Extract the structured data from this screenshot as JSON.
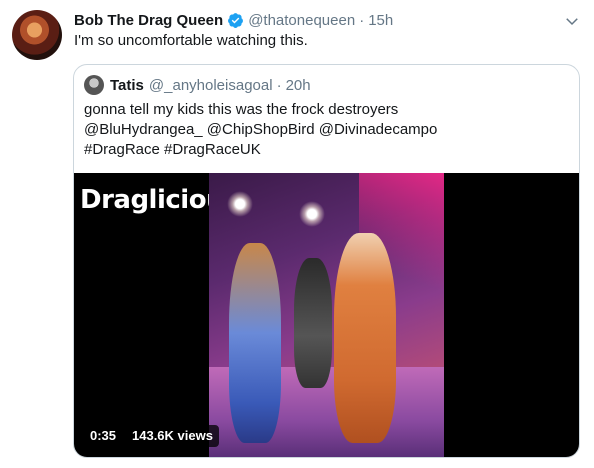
{
  "tweet": {
    "author_name": "Bob The Drag Queen",
    "author_handle": "@thatonequeen",
    "separator": "·",
    "timestamp": "15h",
    "text": "I'm so uncomfortable watching this.",
    "verified": true
  },
  "quoted_tweet": {
    "author_name": "Tatis",
    "author_handle": "@_anyholeisagoal",
    "separator": "·",
    "timestamp": "20h",
    "text_lines": [
      "gonna tell my kids this was the frock destroyers",
      "@BluHydrangea_ @ChipShopBird @Divinadecampo",
      "#DragRace #DragRaceUK"
    ],
    "media": {
      "logo_text": "Draglicious",
      "duration": "0:35",
      "views": "143.6K views"
    }
  },
  "colors": {
    "text": "#14171a",
    "muted": "#657786",
    "verified_blue": "#1da1f2",
    "border": "#ccd6dd"
  },
  "icons": [
    "verified-badge-icon",
    "chevron-down-icon"
  ]
}
